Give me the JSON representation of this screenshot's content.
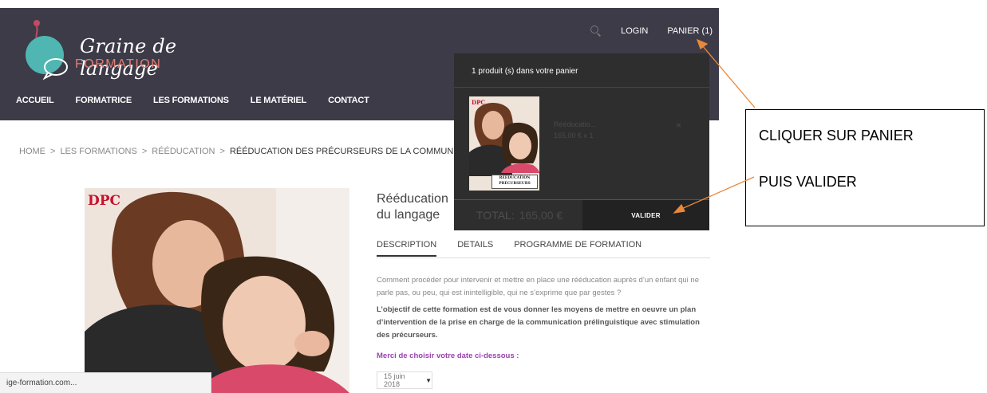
{
  "logo": {
    "line1": "Graine de langage",
    "line2": "FORMATION"
  },
  "top_nav": {
    "login": "LOGIN",
    "cart": "PANIER (1)"
  },
  "main_nav": [
    "ACCUEIL",
    "FORMATRICE",
    "LES FORMATIONS",
    "LE MATÉRIEL",
    "CONTACT"
  ],
  "breadcrumb": {
    "items": [
      "HOME",
      "LES FORMATIONS",
      "RÉÉDUCATION"
    ],
    "current": "RÉÉDUCATION DES PRÉCURSEURS DE LA COMMUNICATI",
    "separator": ">"
  },
  "product": {
    "image_badge": "DPC",
    "title": "Rééducation du langage",
    "tabs": [
      "DESCRIPTION",
      "DETAILS",
      "PROGRAMME DE FORMATION"
    ],
    "description": "Comment procéder pour intervenir et mettre en place une rééducation auprès d’un enfant qui ne parle pas, ou peu, qui est inintelligible, qui ne s’exprime que par gestes ?",
    "objective": "L’objectif de cette formation est de vous donner les moyens de mettre en oeuvre un plan d’intervention de la prise en charge de la communication prélinguistique avec stimulation des précurseurs.",
    "date_prompt": "Merci de choisir votre date ci-dessous :",
    "date_value": "15 juin 2018"
  },
  "cart": {
    "count_text": "1 produit (s) dans votre panier",
    "item_badge": "DPC",
    "item_banner": "RÉÉDUCATION PRÉCURSEURS",
    "item_name": "Rééducatio...",
    "item_price": "165,00 € x 1",
    "remove": "×",
    "total_label": "TOTAL:",
    "total_value": "165,00 €",
    "validate": "VALIDER"
  },
  "status_bar": "ige-formation.com...",
  "annotation": {
    "line1": "CLIQUER SUR PANIER",
    "line2": "PUIS VALIDER"
  },
  "colors": {
    "header": "#3d3b48",
    "accent_pink": "#e47d72",
    "purple": "#9b42b0",
    "arrow": "#e8893a"
  },
  "icons": [
    "search-icon",
    "speech-bubble-logo-icon",
    "chevron-down-icon"
  ]
}
